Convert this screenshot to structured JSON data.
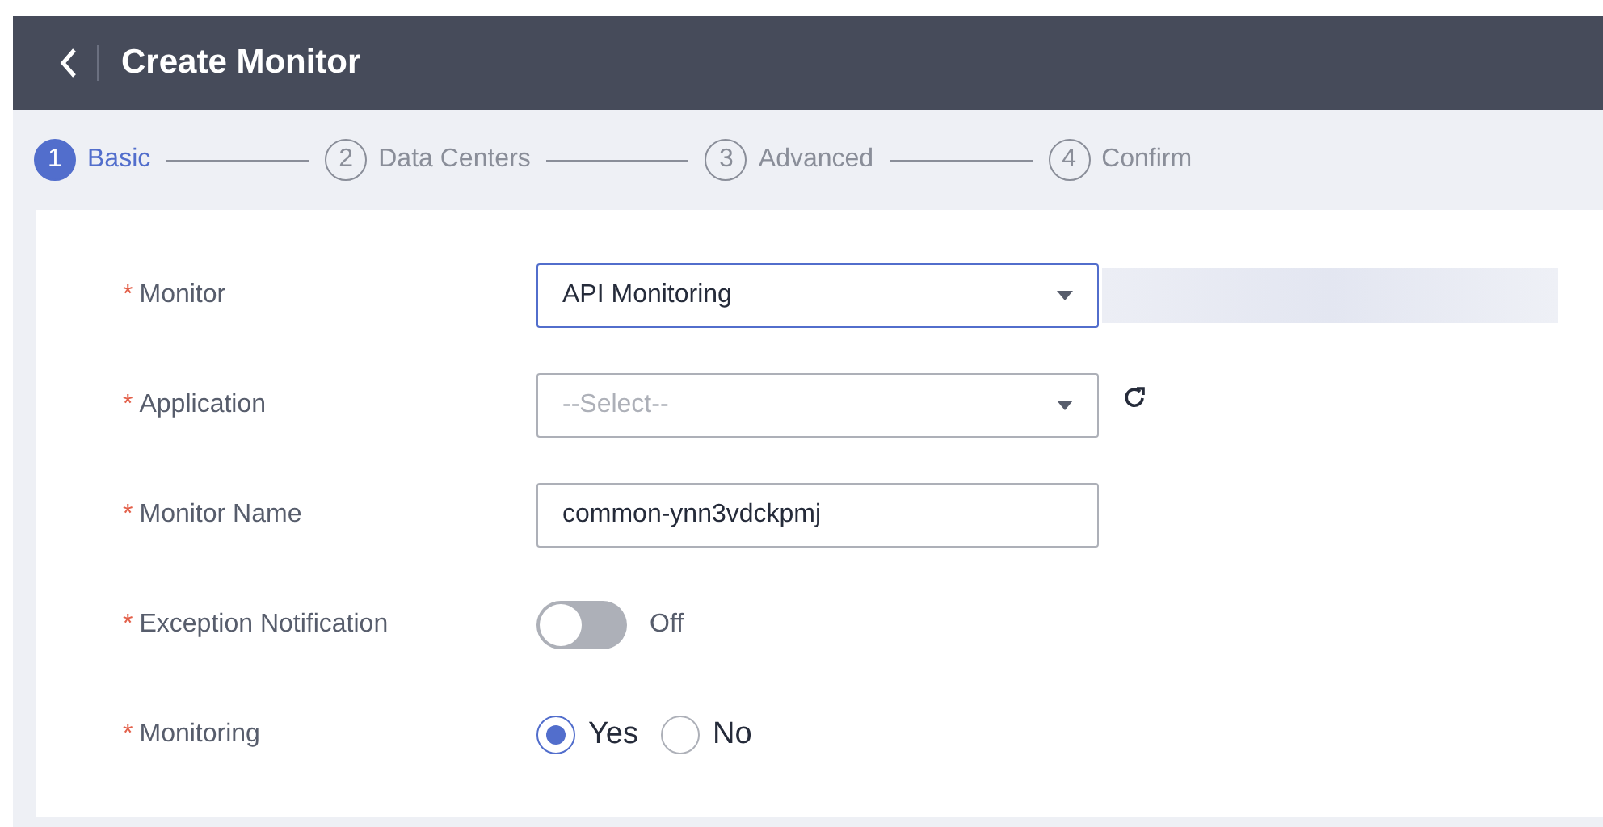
{
  "header": {
    "title": "Create Monitor"
  },
  "steps": [
    {
      "number": "1",
      "label": "Basic",
      "selected": true
    },
    {
      "number": "2",
      "label": "Data Centers",
      "selected": false
    },
    {
      "number": "3",
      "label": "Advanced",
      "selected": false
    },
    {
      "number": "4",
      "label": "Confirm",
      "selected": false
    }
  ],
  "form": [
    {
      "kind": "select",
      "label": "Monitor",
      "required_mark": "*",
      "value": "API Monitoring",
      "focused": true,
      "redacted": true
    },
    {
      "kind": "select",
      "label": "Application",
      "required_mark": "*",
      "placeholder": "--Select--",
      "refresh": true
    },
    {
      "kind": "text",
      "label": "Monitor Name",
      "required_mark": "*",
      "value": "common-ynn3vdckpmj"
    },
    {
      "kind": "switch",
      "label": "Exception Notification",
      "required_mark": "*",
      "on": false,
      "state_text": "Off"
    },
    {
      "kind": "radio",
      "label": "Monitoring",
      "required_mark": "*",
      "options": [
        {
          "label": "Yes",
          "selected": true
        },
        {
          "label": "No",
          "selected": false
        }
      ]
    }
  ]
}
